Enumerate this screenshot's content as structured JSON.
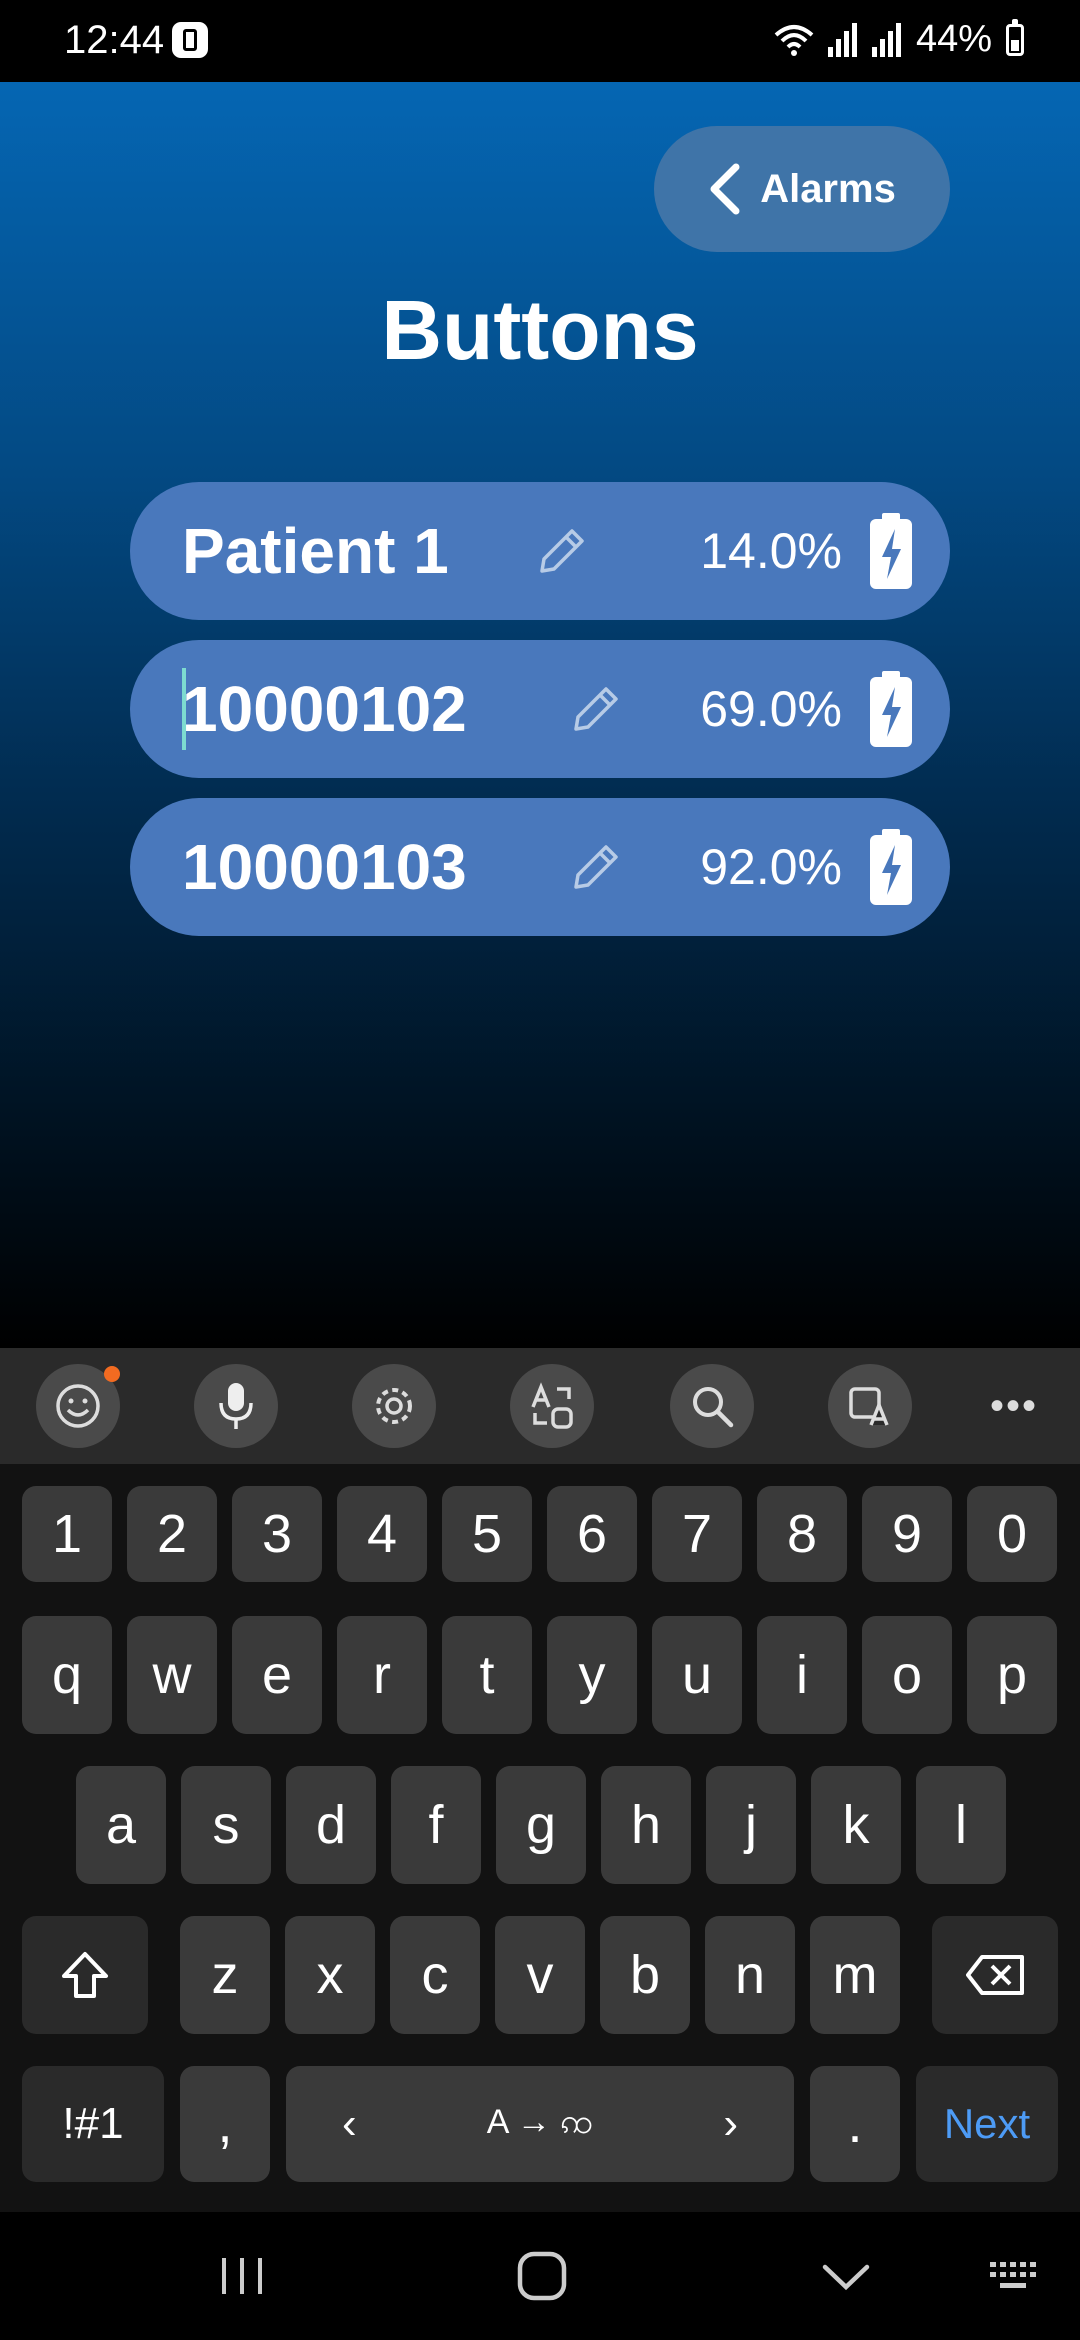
{
  "status_bar": {
    "time": "12:44",
    "battery": "44%"
  },
  "header": {
    "back_label": "Alarms",
    "title": "Buttons"
  },
  "devices": [
    {
      "name": "Patient 1",
      "battery_pct": "14.0%"
    },
    {
      "name": "10000102",
      "battery_pct": "69.0%"
    },
    {
      "name": "10000103",
      "battery_pct": "92.0%"
    }
  ],
  "keyboard": {
    "toolbar_icons": [
      "emoji-icon",
      "microphone-icon",
      "settings-icon",
      "translate-icon",
      "search-icon",
      "image-translate-icon",
      "more-icon"
    ],
    "number_row": [
      "1",
      "2",
      "3",
      "4",
      "5",
      "6",
      "7",
      "8",
      "9",
      "0"
    ],
    "row1": [
      "q",
      "w",
      "e",
      "r",
      "t",
      "y",
      "u",
      "i",
      "o",
      "p"
    ],
    "row2": [
      "a",
      "s",
      "d",
      "f",
      "g",
      "h",
      "j",
      "k",
      "l"
    ],
    "row3": [
      "z",
      "x",
      "c",
      "v",
      "b",
      "n",
      "m"
    ],
    "symbols_label": "!#1",
    "comma": ",",
    "space_left": "‹",
    "space_label": "A → ꩡ",
    "space_right": "›",
    "period": ".",
    "next_label": "Next"
  },
  "colors": {
    "row_bg": "#4978bc",
    "accent": "#4d9bf5",
    "cursor": "#7ddbd0",
    "notif_dot": "#f26b21"
  }
}
